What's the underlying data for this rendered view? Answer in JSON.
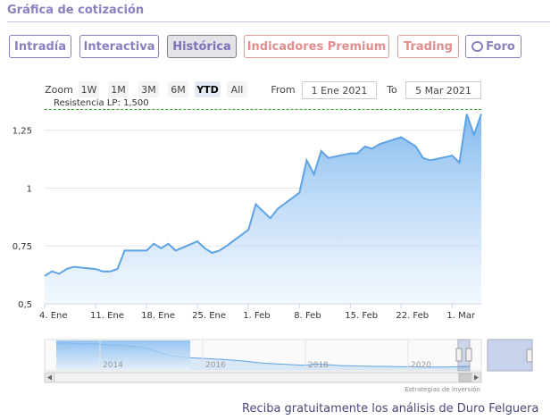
{
  "header": {
    "title": "Gráfica de cotización"
  },
  "tabs": [
    {
      "label": "Intradía",
      "state": "normal"
    },
    {
      "label": "Interactiva",
      "state": "normal"
    },
    {
      "label": "Histórica",
      "state": "active"
    },
    {
      "label": "Indicadores Premium",
      "state": "premium"
    },
    {
      "label": "Trading",
      "state": "premium"
    },
    {
      "label": "Foro",
      "state": "normal",
      "icon": "chat-bubble-icon"
    }
  ],
  "toolbar": {
    "zoom_label": "Zoom",
    "zoom_buttons": [
      "1W",
      "1M",
      "3M",
      "6M",
      "YTD",
      "All"
    ],
    "zoom_active": "YTD",
    "from_label": "From",
    "from_value": "1 Ene 2021",
    "to_label": "To",
    "to_value": "5 Mar 2021"
  },
  "annotation": {
    "resistance_label": "Resistencia LP: 1,500"
  },
  "colors": {
    "accent": "#8b7fc0",
    "premium": "#e08e8e",
    "series_line": "#5ea3e6",
    "series_fill_top": "#7db6ee",
    "resistance": "#2ba02b"
  },
  "chart_data": {
    "type": "area",
    "x": [
      "2021-01-04",
      "2021-01-05",
      "2021-01-06",
      "2021-01-07",
      "2021-01-08",
      "2021-01-11",
      "2021-01-12",
      "2021-01-13",
      "2021-01-14",
      "2021-01-15",
      "2021-01-18",
      "2021-01-19",
      "2021-01-20",
      "2021-01-21",
      "2021-01-22",
      "2021-01-25",
      "2021-01-26",
      "2021-01-27",
      "2021-01-28",
      "2021-01-29",
      "2021-02-01",
      "2021-02-02",
      "2021-02-03",
      "2021-02-04",
      "2021-02-05",
      "2021-02-08",
      "2021-02-09",
      "2021-02-10",
      "2021-02-11",
      "2021-02-12",
      "2021-02-15",
      "2021-02-16",
      "2021-02-17",
      "2021-02-18",
      "2021-02-19",
      "2021-02-22",
      "2021-02-23",
      "2021-02-24",
      "2021-02-25",
      "2021-02-26",
      "2021-03-01",
      "2021-03-02",
      "2021-03-03",
      "2021-03-04",
      "2021-03-05"
    ],
    "values": [
      0.62,
      0.64,
      0.63,
      0.65,
      0.66,
      0.65,
      0.64,
      0.64,
      0.65,
      0.73,
      0.73,
      0.76,
      0.74,
      0.76,
      0.73,
      0.77,
      0.74,
      0.72,
      0.73,
      0.75,
      0.82,
      0.93,
      0.9,
      0.87,
      0.91,
      0.98,
      1.12,
      1.06,
      1.16,
      1.13,
      1.15,
      1.15,
      1.18,
      1.17,
      1.19,
      1.22,
      1.2,
      1.18,
      1.13,
      1.12,
      1.14,
      1.11,
      1.32,
      1.23,
      1.32
    ],
    "x_tick_labels": [
      "4. Ene",
      "11. Ene",
      "18. Ene",
      "25. Ene",
      "1. Feb",
      "8. Feb",
      "15. Feb",
      "22. Feb",
      "1. Mar"
    ],
    "y_tick_labels": [
      "0,5",
      "0,75",
      "1",
      "1,25"
    ],
    "ylim": [
      0.5,
      1.33
    ],
    "grid": true,
    "navigator": {
      "x_tick_labels": [
        "2014",
        "2016",
        "2018",
        "2020"
      ],
      "values": [
        0.9,
        0.92,
        0.88,
        0.9,
        0.86,
        0.84,
        0.82,
        0.78,
        0.7,
        0.55,
        0.48,
        0.42,
        0.4,
        0.38,
        0.36,
        0.33,
        0.3,
        0.25,
        0.22,
        0.2,
        0.18,
        0.16,
        0.2,
        0.18,
        0.15,
        0.14,
        0.13,
        0.12,
        0.12,
        0.11,
        0.11,
        0.1,
        0.1,
        0.1,
        0.11,
        0.12
      ]
    },
    "credit": "Estrategias de Inversión"
  },
  "footer": {
    "text": "Reciba gratuitamente los análisis de Duro Felguera"
  }
}
